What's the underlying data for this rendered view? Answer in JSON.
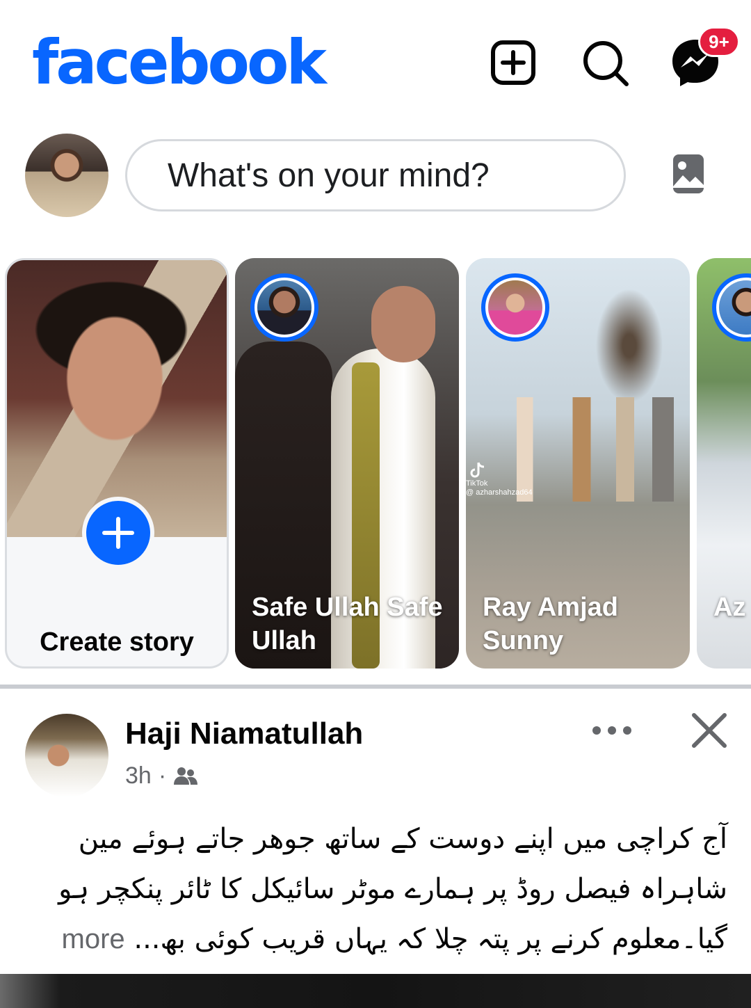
{
  "header": {
    "logo": "facebook",
    "messenger_badge": "9+"
  },
  "composer": {
    "placeholder": "What's on your mind?"
  },
  "stories": {
    "create_label": "Create story",
    "items": [
      {
        "name": "Safe Ullah Safe Ullah"
      },
      {
        "name": "Ray Amjad Sunny"
      },
      {
        "name": "Az"
      }
    ],
    "watermark": "TikTok\n@ azharshahzad64"
  },
  "post": {
    "author": "Haji Niamatullah",
    "time": "3h",
    "dot": "·",
    "text": "آج کراچی میں اپنے دوست کے ساتھ جوھر جاتے ہوئے مین شاہراہ فیصل روڈ پر ہمارے موٹر سائیکل کا ٹائر پنکچر ہو گیا۔معلوم کرنے پر پتہ چلا کہ یہاں قریب کوئی بھ",
    "ellipsis": "... ",
    "more_label": "more"
  },
  "colors": {
    "brand": "#0866ff",
    "badge": "#e41e3f",
    "secondary_text": "#65676b",
    "divider": "#c9ccd1"
  },
  "icons": {
    "create": "plus-square-icon",
    "search": "search-icon",
    "messenger": "messenger-icon",
    "photo": "photo-icon",
    "audience": "friends-icon",
    "menu": "more-horizontal-icon",
    "close": "close-icon"
  }
}
